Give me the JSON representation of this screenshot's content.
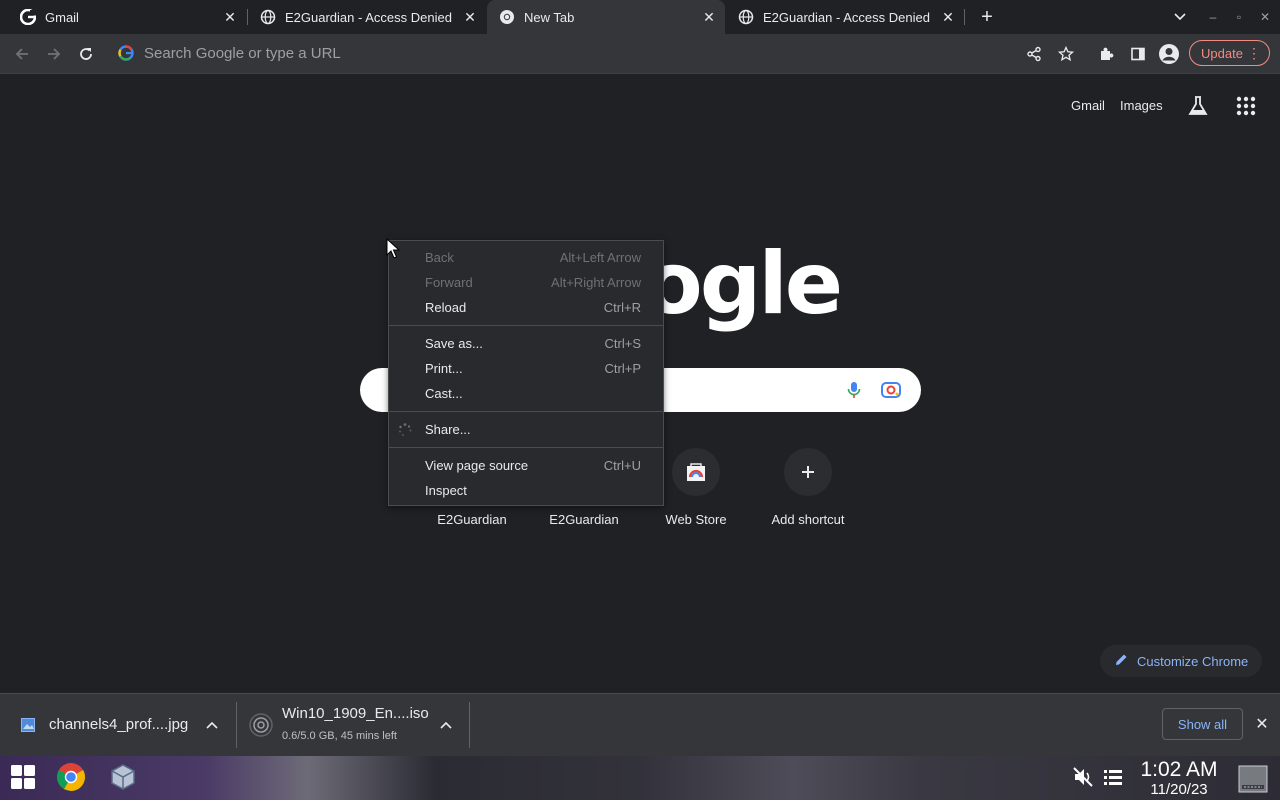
{
  "tabs": [
    {
      "title": "Gmail",
      "favicon": "google-g-icon",
      "active": false
    },
    {
      "title": "E2Guardian - Access Denied",
      "favicon": "globe-icon",
      "active": false
    },
    {
      "title": "New Tab",
      "favicon": "chrome-icon",
      "active": true
    },
    {
      "title": "E2Guardian - Access Denied",
      "favicon": "globe-icon",
      "active": false
    }
  ],
  "toolbar": {
    "omnibox_placeholder": "Search Google or type a URL",
    "update_label": "Update"
  },
  "ntp": {
    "links": {
      "gmail": "Gmail",
      "images": "Images"
    },
    "logo_text": "Google",
    "shortcuts": [
      {
        "label": "E2Guardian"
      },
      {
        "label": "E2Guardian"
      },
      {
        "label": "Web Store"
      },
      {
        "label": "Add shortcut"
      }
    ],
    "customize_label": "Customize Chrome"
  },
  "context_menu": {
    "items": [
      {
        "label": "Back",
        "shortcut": "Alt+Left Arrow",
        "enabled": false
      },
      {
        "label": "Forward",
        "shortcut": "Alt+Right Arrow",
        "enabled": false
      },
      {
        "label": "Reload",
        "shortcut": "Ctrl+R",
        "enabled": true
      },
      {
        "label": "Save as...",
        "shortcut": "Ctrl+S",
        "enabled": true
      },
      {
        "label": "Print...",
        "shortcut": "Ctrl+P",
        "enabled": true
      },
      {
        "label": "Cast...",
        "shortcut": "",
        "enabled": true
      },
      {
        "label": "Share...",
        "shortcut": "",
        "enabled": true
      },
      {
        "label": "View page source",
        "shortcut": "Ctrl+U",
        "enabled": true
      },
      {
        "label": "Inspect",
        "shortcut": "",
        "enabled": true
      }
    ]
  },
  "downloads": {
    "items": [
      {
        "name": "channels4_prof....jpg",
        "status": ""
      },
      {
        "name": "Win10_1909_En....iso",
        "status": "0.6/5.0 GB, 45 mins left"
      }
    ],
    "show_all": "Show all"
  },
  "taskbar": {
    "time": "1:02 AM",
    "date": "11/20/23"
  },
  "colors": {
    "accent": "#8ab4f8",
    "update": "#f28b82",
    "background": "#202124"
  }
}
